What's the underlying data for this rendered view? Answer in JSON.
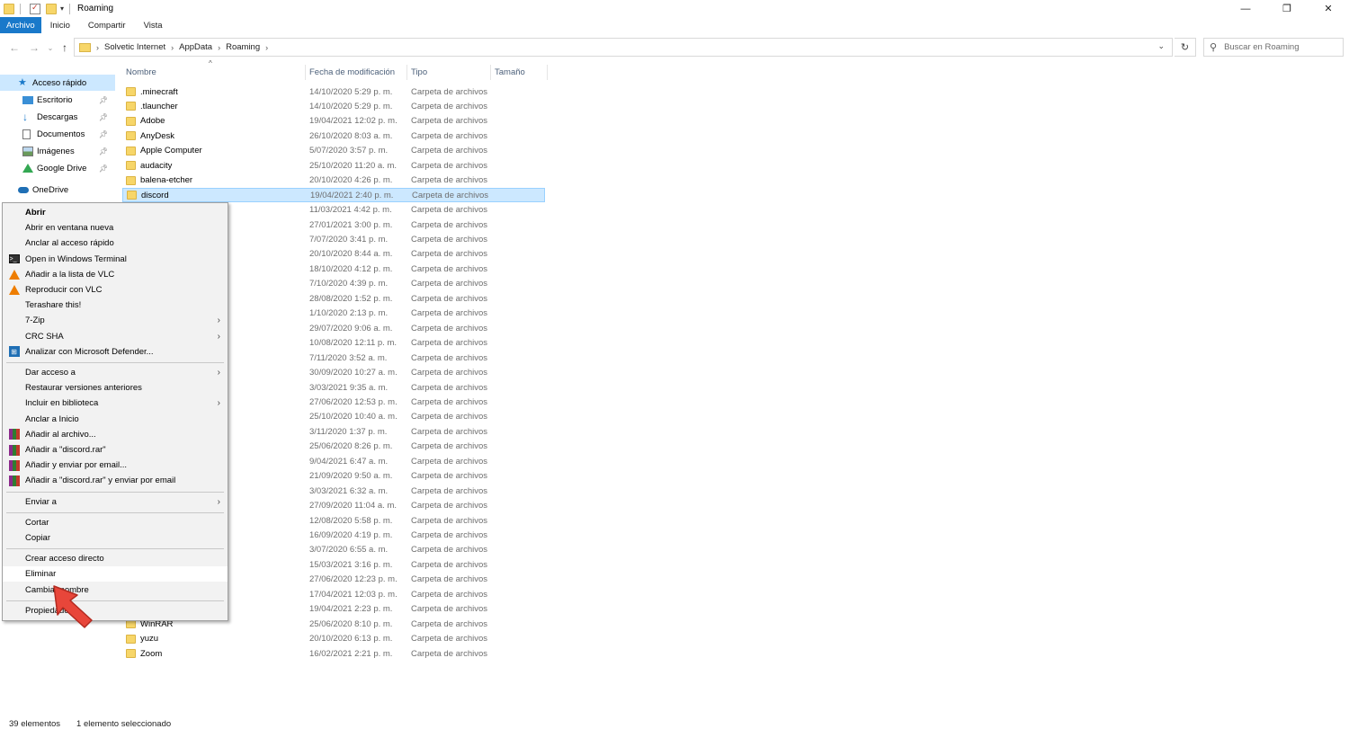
{
  "window": {
    "title": "Roaming",
    "minimize": "—",
    "restore": "❐",
    "close": "✕"
  },
  "ribbon": {
    "tabs": [
      "Archivo",
      "Inicio",
      "Compartir",
      "Vista"
    ]
  },
  "address": {
    "crumbs": [
      "Solvetic Internet",
      "AppData",
      "Roaming"
    ],
    "search_placeholder": "Buscar en Roaming"
  },
  "navpane": {
    "items": [
      {
        "label": "Acceso rápido",
        "icon": "star-icon",
        "active": true,
        "pinned": false
      },
      {
        "label": "Escritorio",
        "icon": "desktop-icon",
        "active": false,
        "pinned": true
      },
      {
        "label": "Descargas",
        "icon": "download-icon",
        "active": false,
        "pinned": true
      },
      {
        "label": "Documentos",
        "icon": "document-icon",
        "active": false,
        "pinned": true
      },
      {
        "label": "Imágenes",
        "icon": "pictures-icon",
        "active": false,
        "pinned": true
      },
      {
        "label": "Google Drive",
        "icon": "google-drive-icon",
        "active": false,
        "pinned": true
      },
      {
        "label": "OneDrive",
        "icon": "onedrive-icon",
        "active": false,
        "pinned": false
      }
    ]
  },
  "columns": {
    "name": "Nombre",
    "date": "Fecha de modificación",
    "type": "Tipo",
    "size": "Tamaño"
  },
  "files": [
    {
      "name": ".minecraft",
      "date": "14/10/2020 5:29 p. m.",
      "type": "Carpeta de archivos"
    },
    {
      "name": ".tlauncher",
      "date": "14/10/2020 5:29 p. m.",
      "type": "Carpeta de archivos"
    },
    {
      "name": "Adobe",
      "date": "19/04/2021 12:02 p. m.",
      "type": "Carpeta de archivos"
    },
    {
      "name": "AnyDesk",
      "date": "26/10/2020 8:03 a. m.",
      "type": "Carpeta de archivos"
    },
    {
      "name": "Apple Computer",
      "date": "5/07/2020 3:57 p. m.",
      "type": "Carpeta de archivos"
    },
    {
      "name": "audacity",
      "date": "25/10/2020 11:20 a. m.",
      "type": "Carpeta de archivos"
    },
    {
      "name": "balena-etcher",
      "date": "20/10/2020 4:26 p. m.",
      "type": "Carpeta de archivos"
    },
    {
      "name": "discord",
      "date": "19/04/2021 2:40 p. m.",
      "type": "Carpeta de archivos",
      "selected": true
    },
    {
      "name": "",
      "date": "11/03/2021 4:42 p. m.",
      "type": "Carpeta de archivos"
    },
    {
      "name": "",
      "date": "27/01/2021 3:00 p. m.",
      "type": "Carpeta de archivos"
    },
    {
      "name": "",
      "date": "7/07/2020 3:41 p. m.",
      "type": "Carpeta de archivos"
    },
    {
      "name": "",
      "date": "20/10/2020 8:44 a. m.",
      "type": "Carpeta de archivos"
    },
    {
      "name": "",
      "date": "18/10/2020 4:12 p. m.",
      "type": "Carpeta de archivos"
    },
    {
      "name": "",
      "date": "7/10/2020 4:39 p. m.",
      "type": "Carpeta de archivos"
    },
    {
      "name": "",
      "date": "28/08/2020 1:52 p. m.",
      "type": "Carpeta de archivos"
    },
    {
      "name": "",
      "date": "1/10/2020 2:13 p. m.",
      "type": "Carpeta de archivos"
    },
    {
      "name": "",
      "date": "29/07/2020 9:06 a. m.",
      "type": "Carpeta de archivos"
    },
    {
      "name": "",
      "date": "10/08/2020 12:11 p. m.",
      "type": "Carpeta de archivos"
    },
    {
      "name": "",
      "date": "7/11/2020 3:52 a. m.",
      "type": "Carpeta de archivos"
    },
    {
      "name": "",
      "date": "30/09/2020 10:27 a. m.",
      "type": "Carpeta de archivos"
    },
    {
      "name": "",
      "date": "3/03/2021 9:35 a. m.",
      "type": "Carpeta de archivos"
    },
    {
      "name": "",
      "date": "27/06/2020 12:53 p. m.",
      "type": "Carpeta de archivos"
    },
    {
      "name": "",
      "date": "25/10/2020 10:40 a. m.",
      "type": "Carpeta de archivos"
    },
    {
      "name": "",
      "date": "3/11/2020 1:37 p. m.",
      "type": "Carpeta de archivos"
    },
    {
      "name": "",
      "date": "25/06/2020 8:26 p. m.",
      "type": "Carpeta de archivos"
    },
    {
      "name": "",
      "date": "9/04/2021 6:47 a. m.",
      "type": "Carpeta de archivos"
    },
    {
      "name": "",
      "date": "21/09/2020 9:50 a. m.",
      "type": "Carpeta de archivos"
    },
    {
      "name": "",
      "date": "3/03/2021 6:32 a. m.",
      "type": "Carpeta de archivos"
    },
    {
      "name": "",
      "date": "27/09/2020 11:04 a. m.",
      "type": "Carpeta de archivos"
    },
    {
      "name": "",
      "date": "12/08/2020 5:58 p. m.",
      "type": "Carpeta de archivos"
    },
    {
      "name": "",
      "date": "16/09/2020 4:19 p. m.",
      "type": "Carpeta de archivos"
    },
    {
      "name": "",
      "date": "3/07/2020 6:55 a. m.",
      "type": "Carpeta de archivos"
    },
    {
      "name": "",
      "date": "15/03/2021 3:16 p. m.",
      "type": "Carpeta de archivos"
    },
    {
      "name": "",
      "date": "27/06/2020 12:23 p. m.",
      "type": "Carpeta de archivos"
    },
    {
      "name": "",
      "date": "17/04/2021 12:03 p. m.",
      "type": "Carpeta de archivos"
    },
    {
      "name": "",
      "date": "19/04/2021 2:23 p. m.",
      "type": "Carpeta de archivos"
    },
    {
      "name": "WinRAR",
      "date": "25/06/2020 8:10 p. m.",
      "type": "Carpeta de archivos"
    },
    {
      "name": "yuzu",
      "date": "20/10/2020 6:13 p. m.",
      "type": "Carpeta de archivos"
    },
    {
      "name": "Zoom",
      "date": "16/02/2021 2:21 p. m.",
      "type": "Carpeta de archivos"
    }
  ],
  "context_menu": {
    "items": [
      {
        "label": "Abrir",
        "bold": true,
        "icon": "",
        "submenu": false
      },
      {
        "label": "Abrir en ventana nueva",
        "icon": "",
        "submenu": false
      },
      {
        "label": "Anclar al acceso rápido",
        "icon": "",
        "submenu": false
      },
      {
        "label": "Open in Windows Terminal",
        "icon": "terminal-icon",
        "submenu": false
      },
      {
        "label": "Añadir a la lista de VLC",
        "icon": "vlc-icon",
        "submenu": false
      },
      {
        "label": "Reproducir con VLC",
        "icon": "vlc-icon",
        "submenu": false
      },
      {
        "label": "Terashare this!",
        "icon": "",
        "submenu": false
      },
      {
        "label": "7-Zip",
        "icon": "",
        "submenu": true
      },
      {
        "label": "CRC SHA",
        "icon": "",
        "submenu": true
      },
      {
        "label": "Analizar con Microsoft Defender...",
        "icon": "defender-icon",
        "submenu": false
      },
      {
        "sep": true
      },
      {
        "label": "Dar acceso a",
        "icon": "",
        "submenu": true
      },
      {
        "label": "Restaurar versiones anteriores",
        "icon": "",
        "submenu": false
      },
      {
        "label": "Incluir en biblioteca",
        "icon": "",
        "submenu": true
      },
      {
        "label": "Anclar a Inicio",
        "icon": "",
        "submenu": false
      },
      {
        "label": "Añadir al archivo...",
        "icon": "winrar-icon",
        "submenu": false
      },
      {
        "label": "Añadir a \"discord.rar\"",
        "icon": "winrar-icon",
        "submenu": false
      },
      {
        "label": "Añadir y enviar por email...",
        "icon": "winrar-icon",
        "submenu": false
      },
      {
        "label": "Añadir a \"discord.rar\" y enviar por email",
        "icon": "winrar-icon",
        "submenu": false
      },
      {
        "sep": true
      },
      {
        "label": "Enviar a",
        "icon": "",
        "submenu": true
      },
      {
        "sep": true
      },
      {
        "label": "Cortar",
        "icon": "",
        "submenu": false
      },
      {
        "label": "Copiar",
        "icon": "",
        "submenu": false
      },
      {
        "sep": true
      },
      {
        "label": "Crear acceso directo",
        "icon": "",
        "submenu": false
      },
      {
        "label": "Eliminar",
        "icon": "",
        "submenu": false,
        "hover": true
      },
      {
        "label": "Cambiar nombre",
        "icon": "",
        "submenu": false
      },
      {
        "sep": true
      },
      {
        "label": "Propiedades",
        "icon": "",
        "submenu": false
      }
    ]
  },
  "status": {
    "count": "39 elementos",
    "selected": "1 elemento seleccionado"
  },
  "colors": {
    "accent": "#1979ca",
    "selection": "#cce8ff",
    "pointer": "#e8463a"
  }
}
